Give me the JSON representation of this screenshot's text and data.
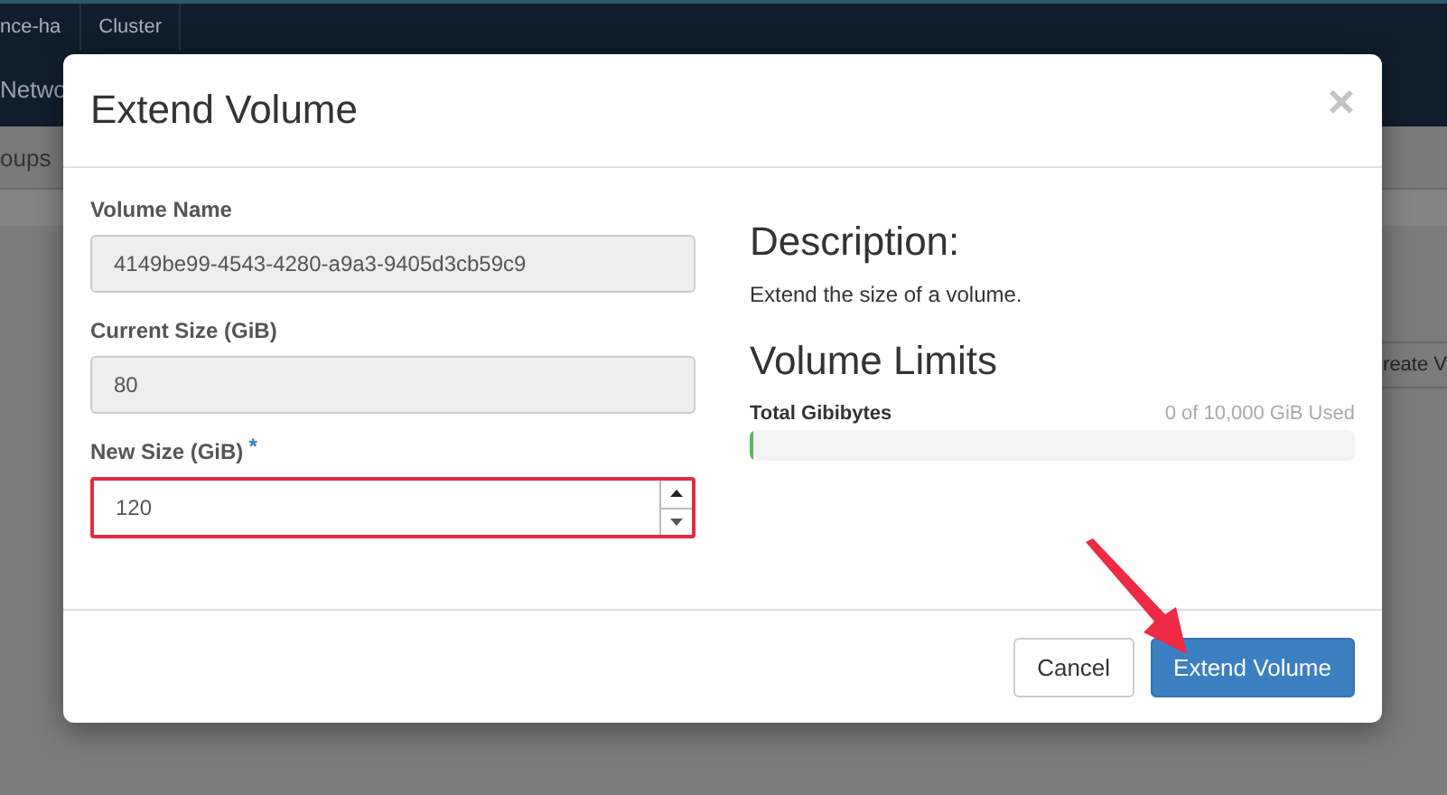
{
  "background": {
    "top_tabs": [
      "nce-ha",
      "Cluster"
    ],
    "nav_label": "Netwo",
    "subnav_label": "oups",
    "side_button": "reate V"
  },
  "modal": {
    "title": "Extend Volume",
    "close": "×",
    "fields": [
      {
        "label": "Volume Name",
        "value": "4149be99-4543-4280-a9a3-9405d3cb59c9",
        "disabled": true,
        "kind": "text"
      },
      {
        "label": "Current Size (GiB)",
        "value": "80",
        "disabled": true,
        "kind": "text"
      },
      {
        "label": "New Size (GiB)",
        "value": "120",
        "required_mark": "*",
        "disabled": false,
        "kind": "number",
        "highlighted": true
      }
    ],
    "description_title": "Description:",
    "description": "Extend the size of a volume.",
    "limits_title": "Volume Limits",
    "limit": {
      "label": "Total Gibibytes",
      "reading": "0 of 10,000 GiB Used",
      "level": 0.006
    },
    "buttons": [
      {
        "label": "Cancel",
        "kind": "default"
      },
      {
        "label": "Extend Volume",
        "kind": "primary"
      }
    ]
  }
}
